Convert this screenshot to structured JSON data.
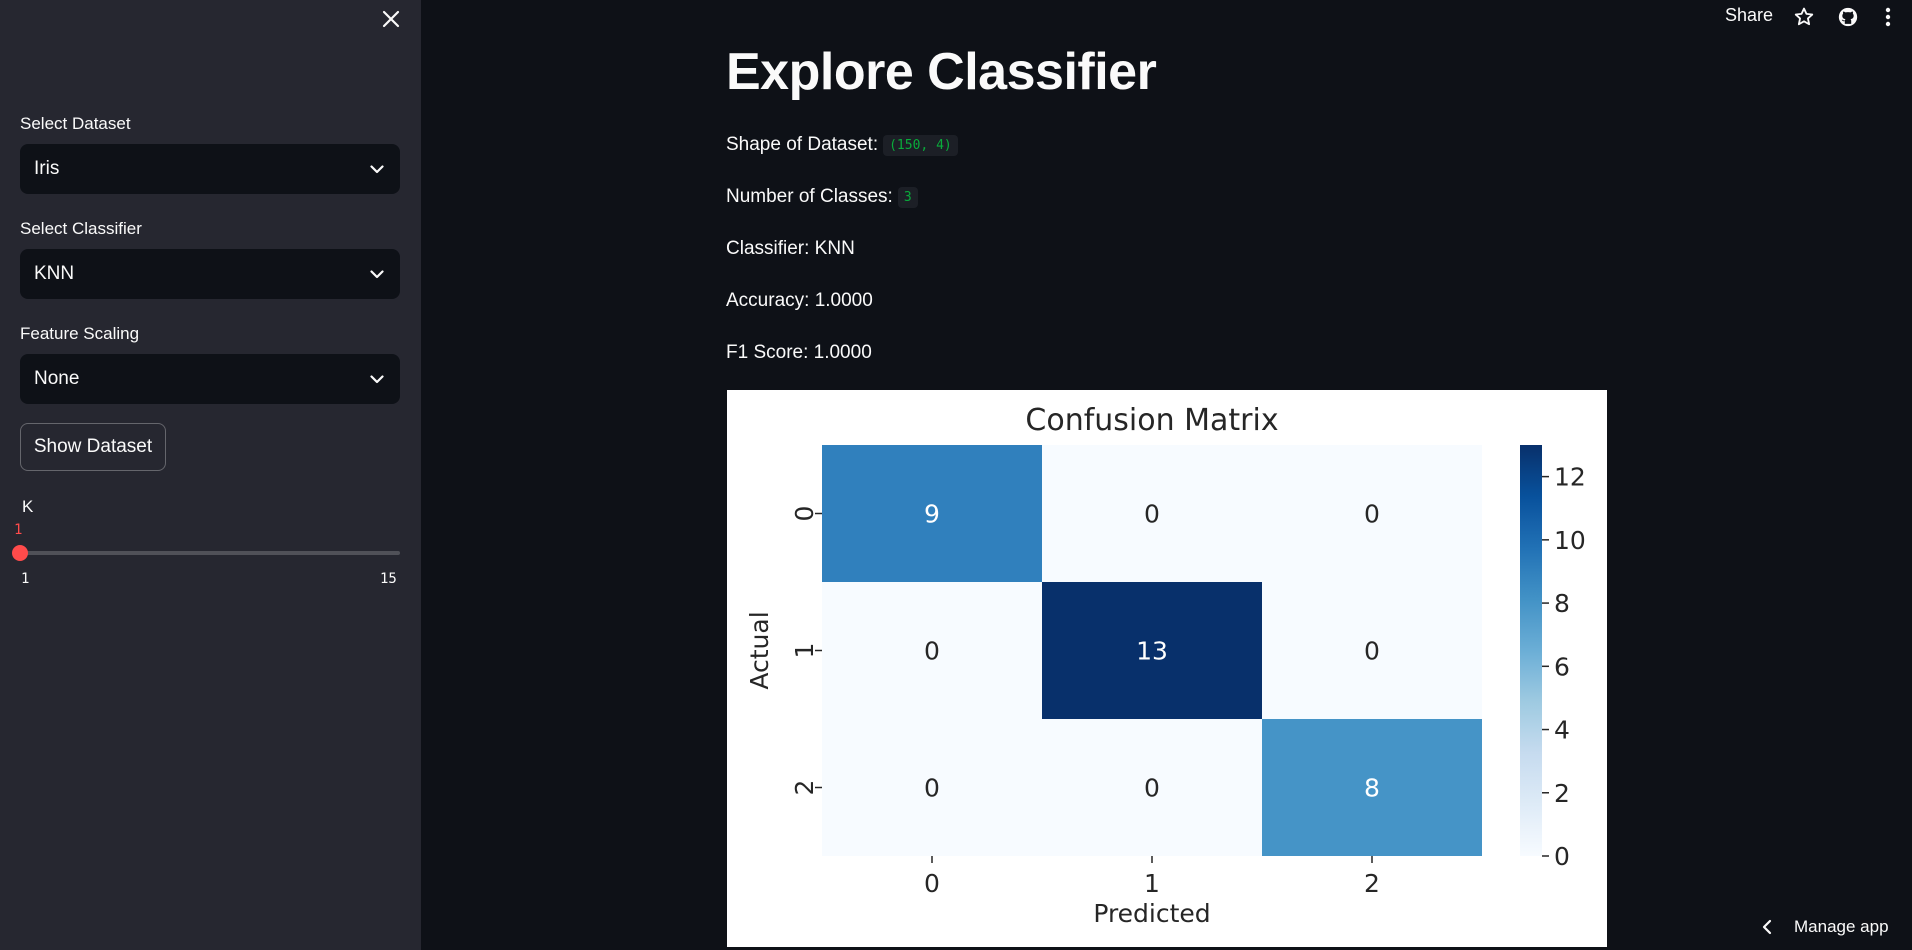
{
  "sidebar": {
    "dataset": {
      "label": "Select Dataset",
      "value": "Iris"
    },
    "classifier": {
      "label": "Select Classifier",
      "value": "KNN"
    },
    "scaling": {
      "label": "Feature Scaling",
      "value": "None"
    },
    "show_dataset_label": "Show Dataset",
    "slider": {
      "label": "K",
      "value": "1",
      "min": "1",
      "max": "15",
      "fraction": 0
    }
  },
  "header": {
    "share_label": "Share"
  },
  "main": {
    "title": "Explore Classifier",
    "shape_label": "Shape of Dataset:",
    "shape_value": "(150, 4)",
    "classes_label": "Number of Classes:",
    "classes_value": "3",
    "classifier_line": "Classifier: KNN",
    "accuracy_line": "Accuracy: 1.0000",
    "f1_line": "F1 Score: 1.0000"
  },
  "manage_app_label": "Manage app",
  "chart_data": {
    "type": "heatmap",
    "title": "Confusion Matrix",
    "xlabel": "Predicted",
    "ylabel": "Actual",
    "x_categories": [
      "0",
      "1",
      "2"
    ],
    "y_categories": [
      "0",
      "1",
      "2"
    ],
    "values": [
      [
        9,
        0,
        0
      ],
      [
        0,
        13,
        0
      ],
      [
        0,
        0,
        8
      ]
    ],
    "colormap": "Blues",
    "colorbar": {
      "min": 0,
      "max": 13,
      "ticks": [
        0,
        2,
        4,
        6,
        8,
        10,
        12
      ]
    }
  }
}
